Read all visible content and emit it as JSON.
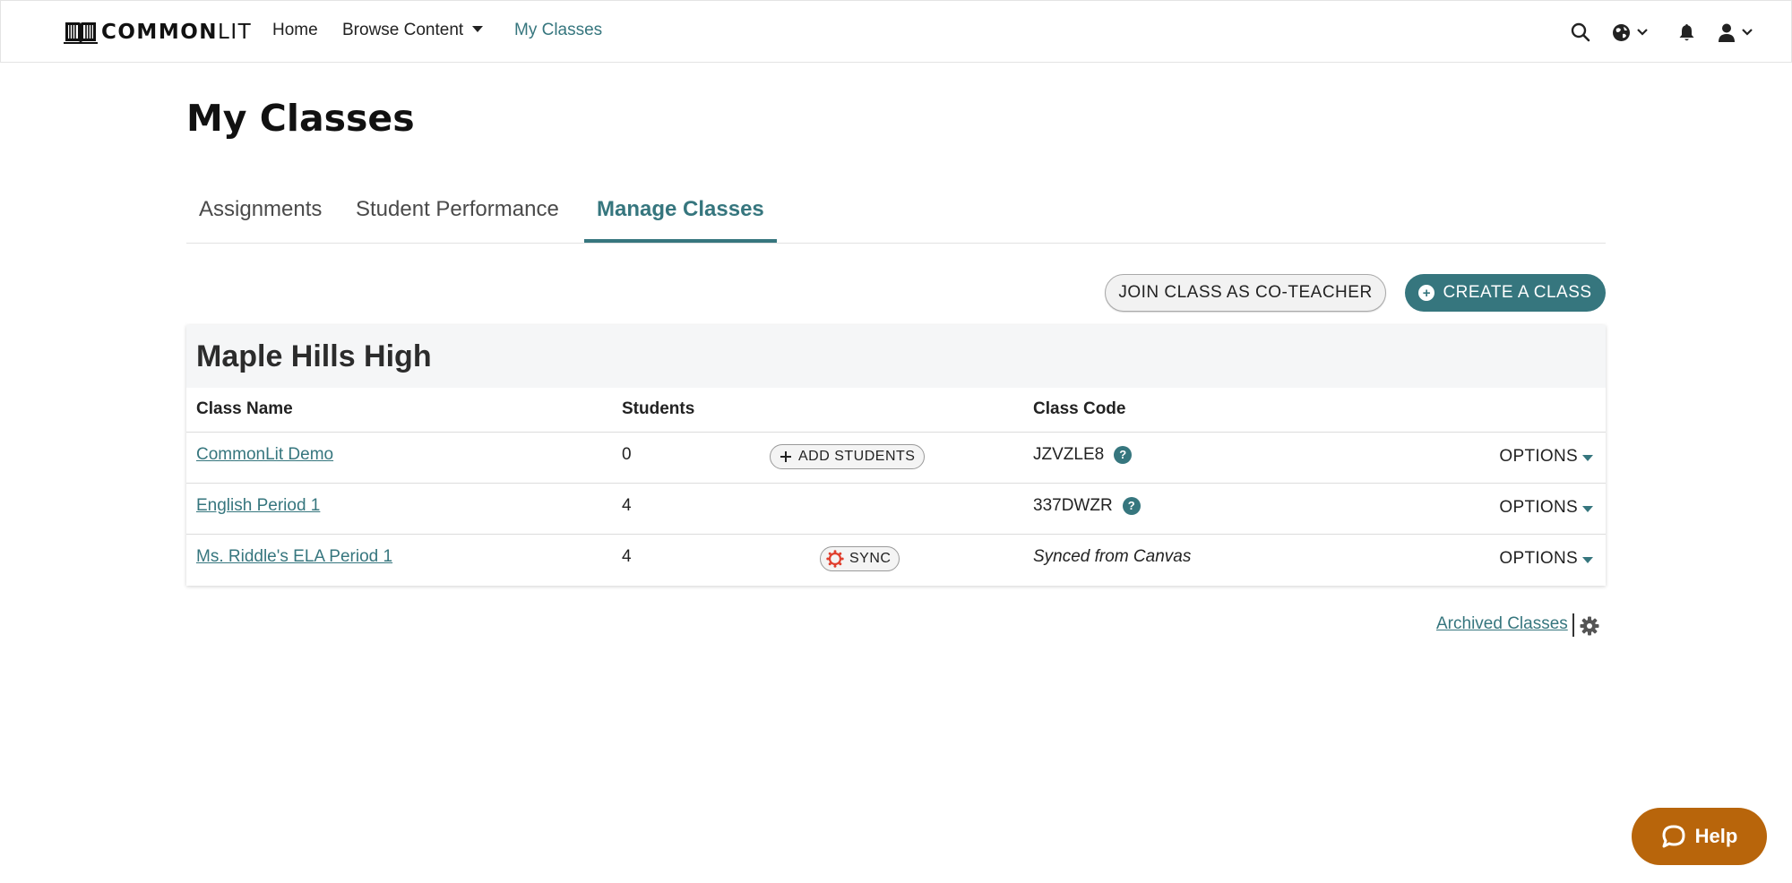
{
  "nav": {
    "logo_bold": "COMMON",
    "logo_light": "LIT",
    "links": [
      {
        "label": "Home"
      },
      {
        "label": "Browse Content"
      },
      {
        "label": "My Classes"
      }
    ],
    "icons": [
      "search-icon",
      "globe-icon",
      "bell-icon",
      "user-icon"
    ]
  },
  "page": {
    "title": "My Classes",
    "tabs": [
      {
        "label": "Assignments"
      },
      {
        "label": "Student Performance"
      },
      {
        "label": "Manage Classes",
        "active": true
      }
    ]
  },
  "actions": {
    "join_label": "JOIN CLASS AS CO-TEACHER",
    "create_label": "CREATE A CLASS"
  },
  "school": {
    "name": "Maple Hills High",
    "columns": [
      "Class Name",
      "Students",
      "Class Code"
    ],
    "rows": [
      {
        "name": "CommonLit Demo",
        "students": "0",
        "action": "ADD STUDENTS",
        "code": "JZVZLE8",
        "options": "OPTIONS"
      },
      {
        "name": "English Period 1",
        "students": "4",
        "action": "",
        "code": "337DWZR",
        "options": "OPTIONS"
      },
      {
        "name": "Ms. Riddle's ELA Period 1",
        "students": "4",
        "action": "SYNC",
        "code": "Synced from Canvas",
        "options": "OPTIONS"
      }
    ]
  },
  "footer": {
    "archived_label": "Archived Classes"
  },
  "help": {
    "label": "Help"
  },
  "colors": {
    "accent": "#36767e",
    "help": "#b8650b"
  }
}
